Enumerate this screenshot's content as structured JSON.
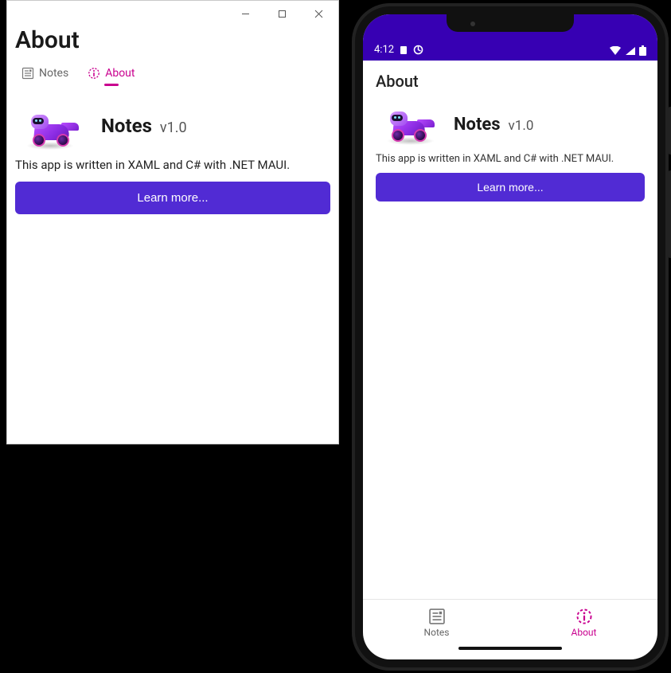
{
  "windows": {
    "header": "About",
    "tabs": [
      {
        "label": "Notes",
        "icon": "notes-icon",
        "active": false
      },
      {
        "label": "About",
        "icon": "info-icon",
        "active": true
      }
    ],
    "app_name": "Notes",
    "version": "v1.0",
    "description": "This app is written in XAML and C# with .NET MAUI.",
    "button": "Learn more..."
  },
  "android": {
    "status": {
      "time": "4:12"
    },
    "appbar_title": "About",
    "app_name": "Notes",
    "version": "v1.0",
    "description": "This app is written in XAML and C# with .NET MAUI.",
    "button": "Learn more...",
    "tabs": [
      {
        "label": "Notes",
        "icon": "notes-icon",
        "active": false
      },
      {
        "label": "About",
        "icon": "info-icon",
        "active": true
      }
    ]
  }
}
